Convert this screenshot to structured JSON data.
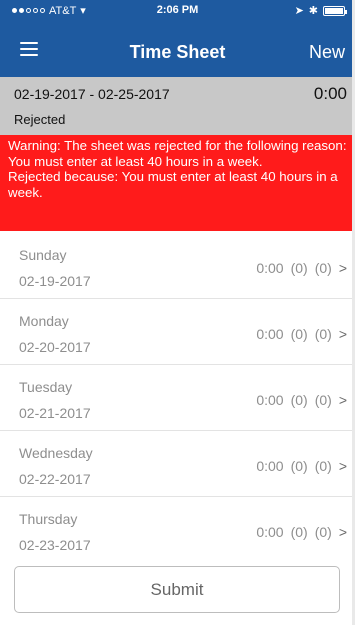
{
  "status_bar": {
    "carrier": "AT&T",
    "time": "2:06 PM"
  },
  "navbar": {
    "title": "Time Sheet",
    "new_label": "New"
  },
  "summary": {
    "date_range": "02-19-2017 - 02-25-2017",
    "total_hours": "0:00",
    "status": "Rejected"
  },
  "warning": {
    "line1": "Warning: The sheet was rejected for the following reason: You must enter at least 40 hours in a week.",
    "line2": "Rejected because: You must enter at least 40 hours in a week."
  },
  "days": [
    {
      "name": "Sunday",
      "date": "02-19-2017",
      "hours": "0:00",
      "count_a": "(0)",
      "count_b": "(0)",
      "chevron": ">"
    },
    {
      "name": "Monday",
      "date": "02-20-2017",
      "hours": "0:00",
      "count_a": "(0)",
      "count_b": "(0)",
      "chevron": ">"
    },
    {
      "name": "Tuesday",
      "date": "02-21-2017",
      "hours": "0:00",
      "count_a": "(0)",
      "count_b": "(0)",
      "chevron": ">"
    },
    {
      "name": "Wednesday",
      "date": "02-22-2017",
      "hours": "0:00",
      "count_a": "(0)",
      "count_b": "(0)",
      "chevron": ">"
    },
    {
      "name": "Thursday",
      "date": "02-23-2017",
      "hours": "0:00",
      "count_a": "(0)",
      "count_b": "(0)",
      "chevron": ">"
    }
  ],
  "submit_label": "Submit",
  "colors": {
    "nav_blue": "#1e5aa0",
    "warning_red": "#ff1b1b",
    "summary_grey": "#c8c8c8"
  }
}
